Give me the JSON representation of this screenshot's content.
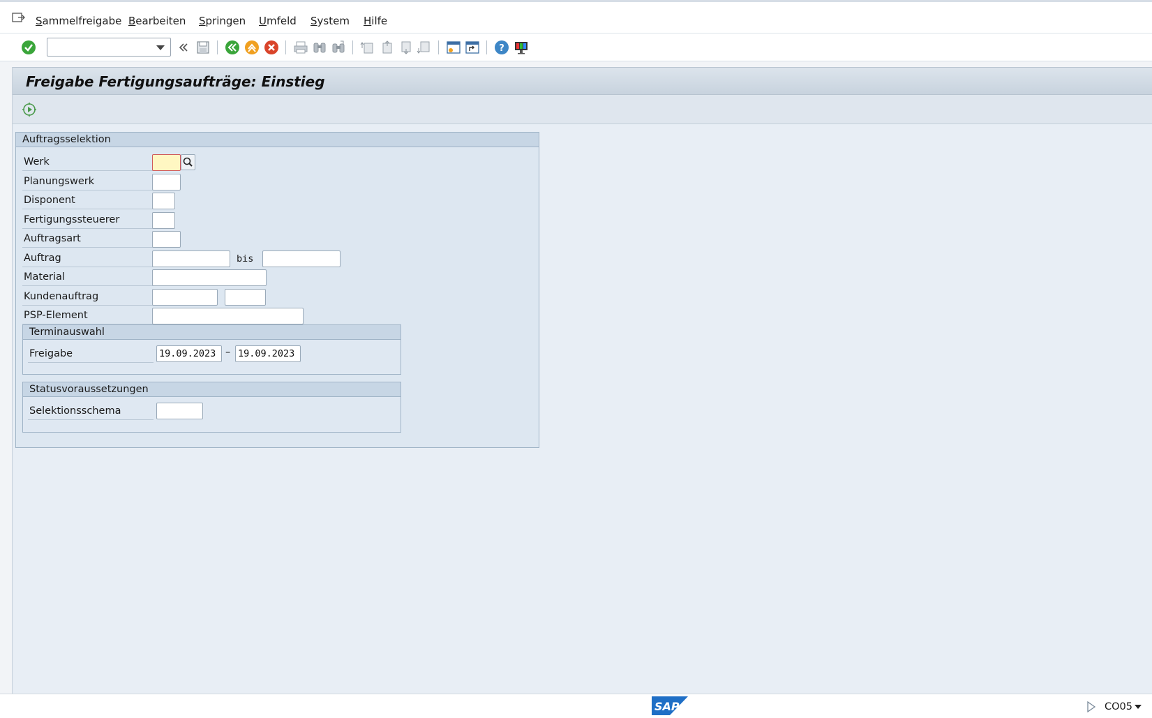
{
  "menubar": {
    "items": [
      "Sammelfreigabe",
      "Bearbeiten",
      "Springen",
      "Umfeld",
      "System",
      "Hilfe"
    ]
  },
  "toolbar": {
    "command_field_value": "",
    "icons": [
      "enter-icon",
      "back-double-icon",
      "save-icon",
      "back-icon",
      "exit-icon",
      "cancel-icon",
      "print-icon",
      "find-icon",
      "find-next-icon",
      "first-page-icon",
      "prev-page-icon",
      "next-page-icon",
      "last-page-icon",
      "new-session-icon",
      "shortcut-icon",
      "help-icon",
      "layout-icon"
    ]
  },
  "title": "Freigabe Fertigungsaufträge: Einstieg",
  "auftragsselektion": {
    "heading": "Auftragsselektion",
    "werk_label": "Werk",
    "werk_value": "",
    "planungswerk_label": "Planungswerk",
    "planungswerk_value": "",
    "disponent_label": "Disponent",
    "disponent_value": "",
    "fertigungssteuerer_label": "Fertigungssteuerer",
    "fertigungssteuerer_value": "",
    "auftragsart_label": "Auftragsart",
    "auftragsart_value": "",
    "auftrag_label": "Auftrag",
    "auftrag_from": "",
    "bis_label": "bis",
    "auftrag_to": "",
    "material_label": "Material",
    "material_value": "",
    "kundenauftrag_label": "Kundenauftrag",
    "kundenauftrag_value": "",
    "kundenauftrag_position": "",
    "psp_label": "PSP-Element",
    "psp_value": ""
  },
  "terminauswahl": {
    "heading": "Terminauswahl",
    "freigabe_label": "Freigabe",
    "freigabe_from": "19.09.2023",
    "dash": "–",
    "freigabe_to": "19.09.2023"
  },
  "statusvoraussetzungen": {
    "heading": "Statusvoraussetzungen",
    "selektionsschema_label": "Selektionsschema",
    "selektionsschema_value": ""
  },
  "footer": {
    "logo_text": "SAP",
    "transaction": "CO05"
  },
  "colors": {
    "accent_green": "#3aa53a",
    "exit_orange": "#f0a020",
    "cancel_red": "#d9442a",
    "sap_blue": "#1f6fc6"
  }
}
